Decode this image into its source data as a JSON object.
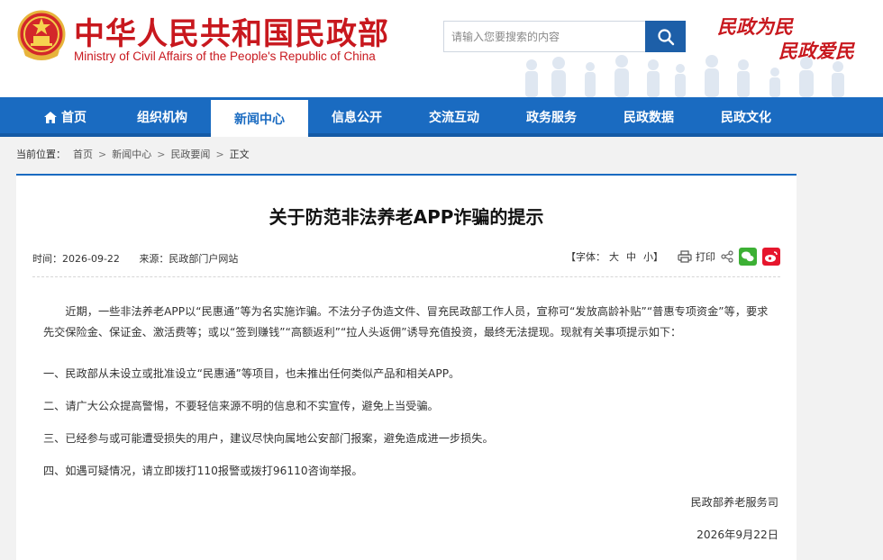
{
  "header": {
    "title_cn": "中华人民共和国民政部",
    "title_en": "Ministry of Civil Affairs of the People's Republic of China",
    "search_placeholder": "请输入您要搜索的内容",
    "slogan_1": "民政为民",
    "slogan_2": "民政爱民"
  },
  "nav": {
    "items": [
      {
        "label": "首页",
        "icon": "home-icon"
      },
      {
        "label": "组织机构"
      },
      {
        "label": "新闻中心",
        "active": true
      },
      {
        "label": "信息公开"
      },
      {
        "label": "交流互动"
      },
      {
        "label": "政务服务"
      },
      {
        "label": "民政数据"
      },
      {
        "label": "民政文化"
      }
    ],
    "accent": "#1a6bc1"
  },
  "breadcrumb": {
    "label": "当前位置：",
    "items": [
      "首页",
      "新闻中心",
      "民政要闻",
      "正文"
    ]
  },
  "article": {
    "title": "关于防范非法养老APP诈骗的提示",
    "date": "时间：2026-09-22",
    "source": "来源：民政部门户网站",
    "font_label": "【字体：",
    "font_large": "大",
    "font_medium": "中",
    "font_small": "小】",
    "print_label": "打印",
    "intro": "近期，一些非法养老APP以“民惠通”等为名实施诈骗。不法分子伪造文件、冒充民政部工作人员，宣称可“发放高龄补贴”“普惠专项资金”等，要求先交保险金、保证金、激活费等；或以“签到赚钱”“高额返利”“拉人头返佣”诱导充值投资，最终无法提现。现就有关事项提示如下：",
    "points": [
      "一、民政部从未设立或批准设立“民惠通”等项目，也未推出任何类似产品和相关APP。",
      "二、请广大公众提高警惕，不要轻信来源不明的信息和不实宣传，避免上当受骗。",
      "三、已经参与或可能遭受损失的用户，建议尽快向属地公安部门报案，避免造成进一步损失。",
      "四、如遇可疑情况，请立即拨打110报警或拨打96110咨询举报。"
    ],
    "signature": "民政部养老服务司",
    "sign_date": "2026年9月22日"
  }
}
